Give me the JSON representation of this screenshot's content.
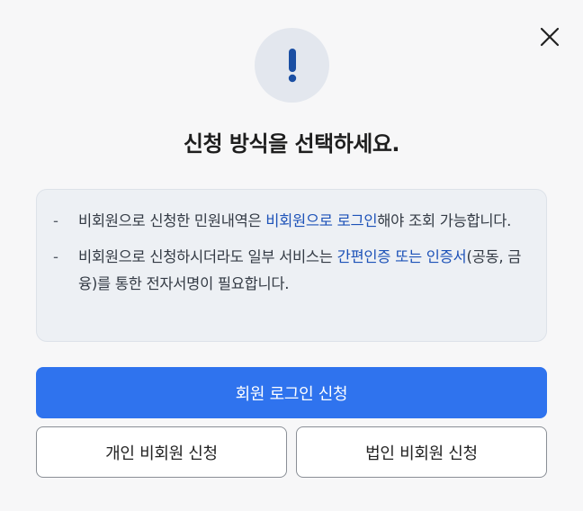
{
  "dialog": {
    "close_icon": "close-icon",
    "alert_icon": "exclamation-icon",
    "title": "신청 방식을 선택하세요.",
    "notices": [
      {
        "dash": "-",
        "before": "비회원으로 신청한 민원내역은 ",
        "highlight": "비회원으로 로그인",
        "after": "해야 조회 가능합니다."
      },
      {
        "dash": "-",
        "before": "비회원으로 신청하시더라도 일부 서비스는 ",
        "highlight": "간편인증 또는 인증서",
        "after": "(공동, 금융)를 통한 전자서명이 필요합니다."
      }
    ],
    "buttons": {
      "member_login": "회원 로그인 신청",
      "individual_guest": "개인 비회원 신청",
      "corporate_guest": "법인 비회원 신청"
    },
    "colors": {
      "primary": "#2f73ee",
      "highlight": "#1d52b8",
      "icon": "#1b4fa3"
    }
  }
}
